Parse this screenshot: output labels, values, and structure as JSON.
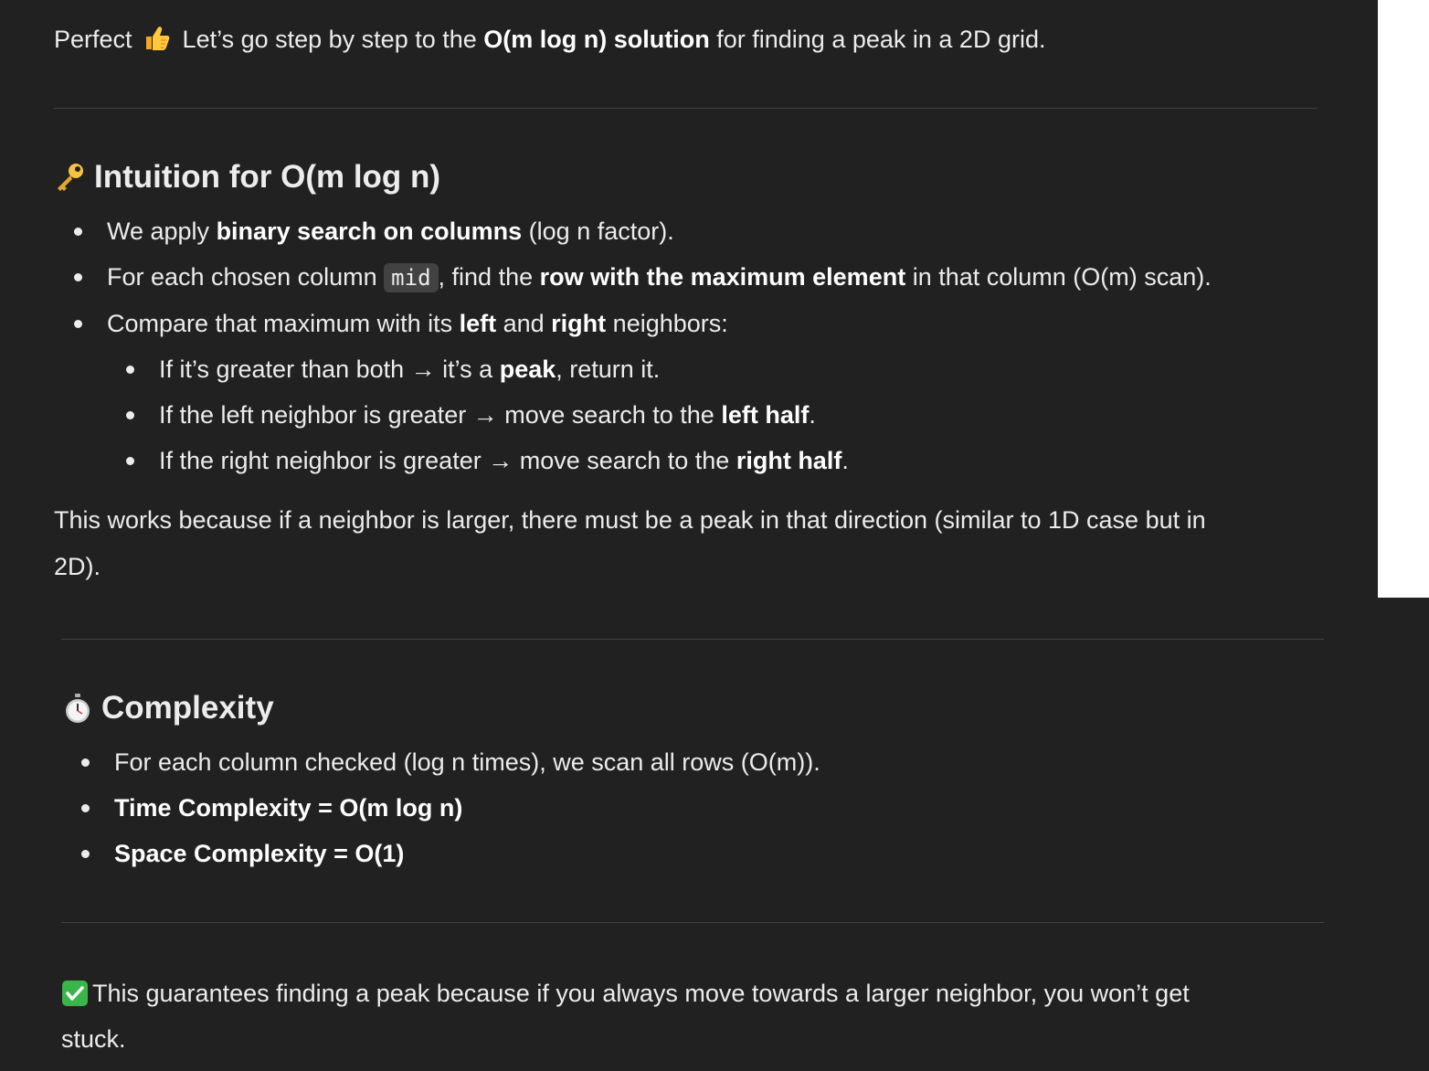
{
  "intro": {
    "before": "Perfect ",
    "emoji": "thumbs-up-icon",
    "mid": " Let’s go step by step to the ",
    "bold": "O(m log n) solution",
    "after": " for finding a peak in a 2D grid."
  },
  "intuition": {
    "heading": "Intuition for O(m log n)",
    "heading_icon": "key-icon",
    "bullets": [
      {
        "pre": "We apply ",
        "bold": "binary search on columns",
        "post": " (log n factor)."
      },
      {
        "pre": "For each chosen column ",
        "code": "mid",
        "mid": ", find the ",
        "bold": "row with the maximum element",
        "post": " in that column (O(m) scan)."
      },
      {
        "pre": "Compare that maximum with its ",
        "bold1": "left",
        "and": " and ",
        "bold2": "right",
        "post": " neighbors:"
      }
    ],
    "sub_bullets": [
      {
        "pre": "If it’s greater than both → it’s a ",
        "bold": "peak",
        "post": ", return it."
      },
      {
        "pre": "If the left neighbor is greater → move search to the ",
        "bold": "left half",
        "post": "."
      },
      {
        "pre": "If the right neighbor is greater → move search to the ",
        "bold": "right half",
        "post": "."
      }
    ],
    "explanation_line1": "This works because if a neighbor is larger, there must be a peak in that direction (similar to 1D case but in",
    "explanation_line2": "2D)."
  },
  "complexity": {
    "heading": "Complexity",
    "heading_icon": "stopwatch-icon",
    "bullets": [
      {
        "text": "For each column checked (log n times), we scan all rows (O(m))."
      },
      {
        "bold": "Time Complexity = O(m log n)"
      },
      {
        "bold": "Space Complexity = O(1)"
      }
    ]
  },
  "conclusion": {
    "icon": "check-mark-icon",
    "line1": "This guarantees finding a peak because if you always move towards a larger neighbor, you won’t get",
    "line2": "stuck."
  },
  "colors": {
    "background": "#212121",
    "text": "#ececec",
    "divider": "#424242",
    "check_green": "#3bb54a"
  }
}
